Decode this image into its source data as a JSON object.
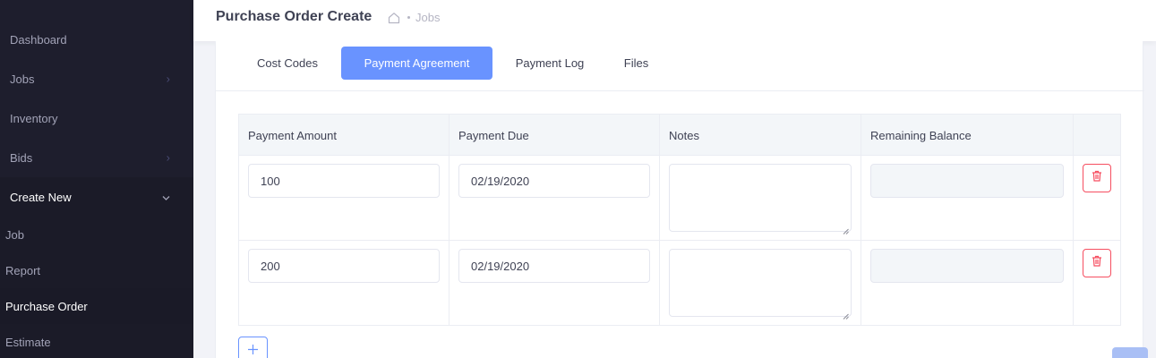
{
  "sidebar": {
    "items": [
      {
        "label": "Dashboard"
      },
      {
        "label": "Jobs"
      },
      {
        "label": "Inventory"
      },
      {
        "label": "Bids"
      },
      {
        "label": "Create New"
      }
    ],
    "submenu": [
      {
        "label": "Job"
      },
      {
        "label": "Report"
      },
      {
        "label": "Purchase Order"
      },
      {
        "label": "Estimate"
      }
    ]
  },
  "header": {
    "title": "Purchase Order Create",
    "breadcrumb": "Jobs"
  },
  "tabs": [
    {
      "label": "Cost Codes"
    },
    {
      "label": "Payment Agreement"
    },
    {
      "label": "Payment Log"
    },
    {
      "label": "Files"
    }
  ],
  "table": {
    "columns": [
      "Payment Amount",
      "Payment Due",
      "Notes",
      "Remaining Balance"
    ],
    "rows": [
      {
        "amount": "100",
        "due": "02/19/2020",
        "notes": "",
        "balance": ""
      },
      {
        "amount": "200",
        "due": "02/19/2020",
        "notes": "",
        "balance": ""
      }
    ]
  },
  "icons": {
    "home": "home-icon",
    "delete": "trash-icon",
    "add": "plus-icon",
    "chevron_right": "chevron-right-icon",
    "chevron_down": "chevron-down-icon"
  },
  "colors": {
    "primary": "#6993ff",
    "danger": "#f64e60",
    "sidebar_bg": "#1e1e2d"
  }
}
